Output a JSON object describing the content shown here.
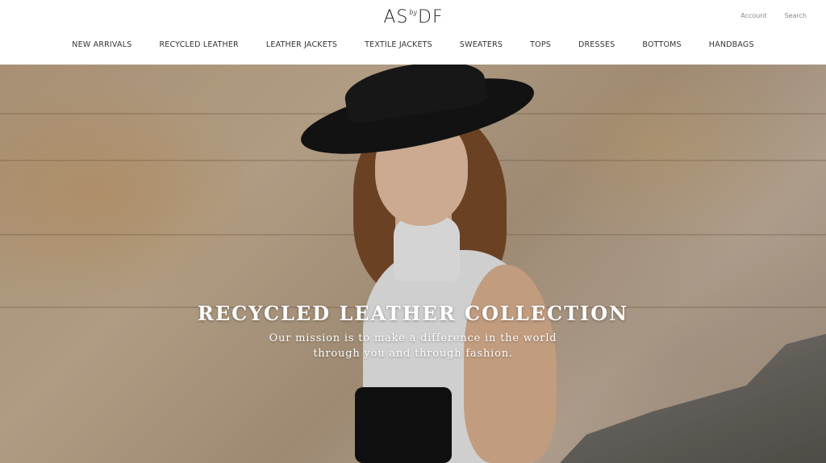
{
  "header": {
    "logo": {
      "left": "AS",
      "by": "by",
      "right": "DF"
    },
    "utils": [
      {
        "label": "Account"
      },
      {
        "label": "Search"
      }
    ],
    "nav": [
      {
        "label": "NEW ARRIVALS"
      },
      {
        "label": "RECYCLED LEATHER"
      },
      {
        "label": "LEATHER JACKETS"
      },
      {
        "label": "TEXTILE JACKETS"
      },
      {
        "label": "SWEATERS"
      },
      {
        "label": "TOPS"
      },
      {
        "label": "DRESSES"
      },
      {
        "label": "BOTTOMS"
      },
      {
        "label": "HANDBAGS"
      }
    ]
  },
  "hero": {
    "title": "RECYCLED LEATHER COLLECTION",
    "subtitle_line1": "Our mission is to make a difference in the world",
    "subtitle_line2": "through you and through fashion."
  },
  "colors": {
    "header_bg": "#ffffff",
    "nav_text": "#333333",
    "hero_text": "#ffffff",
    "stone": "#bfa484"
  }
}
